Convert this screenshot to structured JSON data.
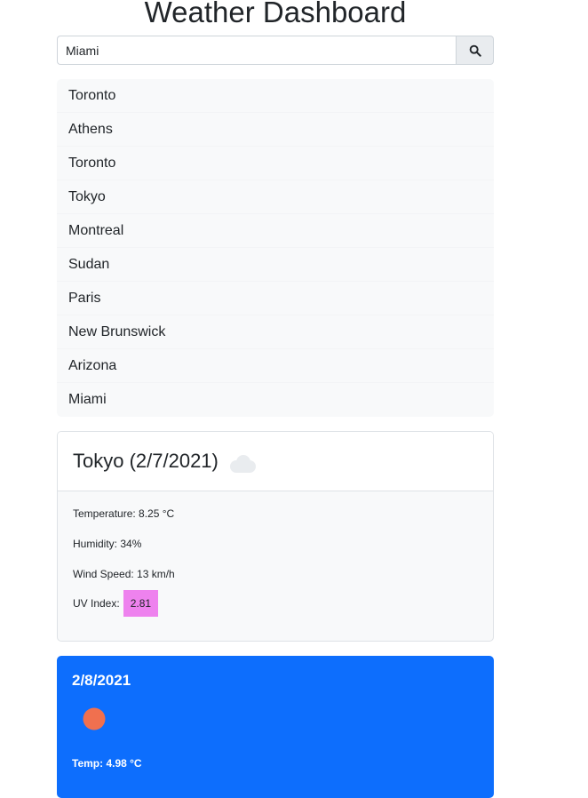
{
  "header": {
    "title": "Weather Dashboard"
  },
  "search": {
    "value": "Miami",
    "button_icon": "search-icon"
  },
  "history": [
    "Toronto",
    "Athens",
    "Toronto",
    "Tokyo",
    "Montreal",
    "Sudan",
    "Paris",
    "New Brunswick",
    "Arizona",
    "Miami"
  ],
  "current": {
    "title": "Tokyo (2/7/2021)",
    "icon": "cloud-icon",
    "temperature": "Temperature: 8.25 °C",
    "humidity": "Humidity: 34%",
    "wind": "Wind Speed: 13 km/h",
    "uv_label": "UV Index:",
    "uv_value": "2.81",
    "uv_color": "#ee82ee"
  },
  "forecast": [
    {
      "date": "2/8/2021",
      "icon": "sun-icon",
      "temp": "Temp: 4.98 °C",
      "card_color": "#0d6efd"
    }
  ]
}
